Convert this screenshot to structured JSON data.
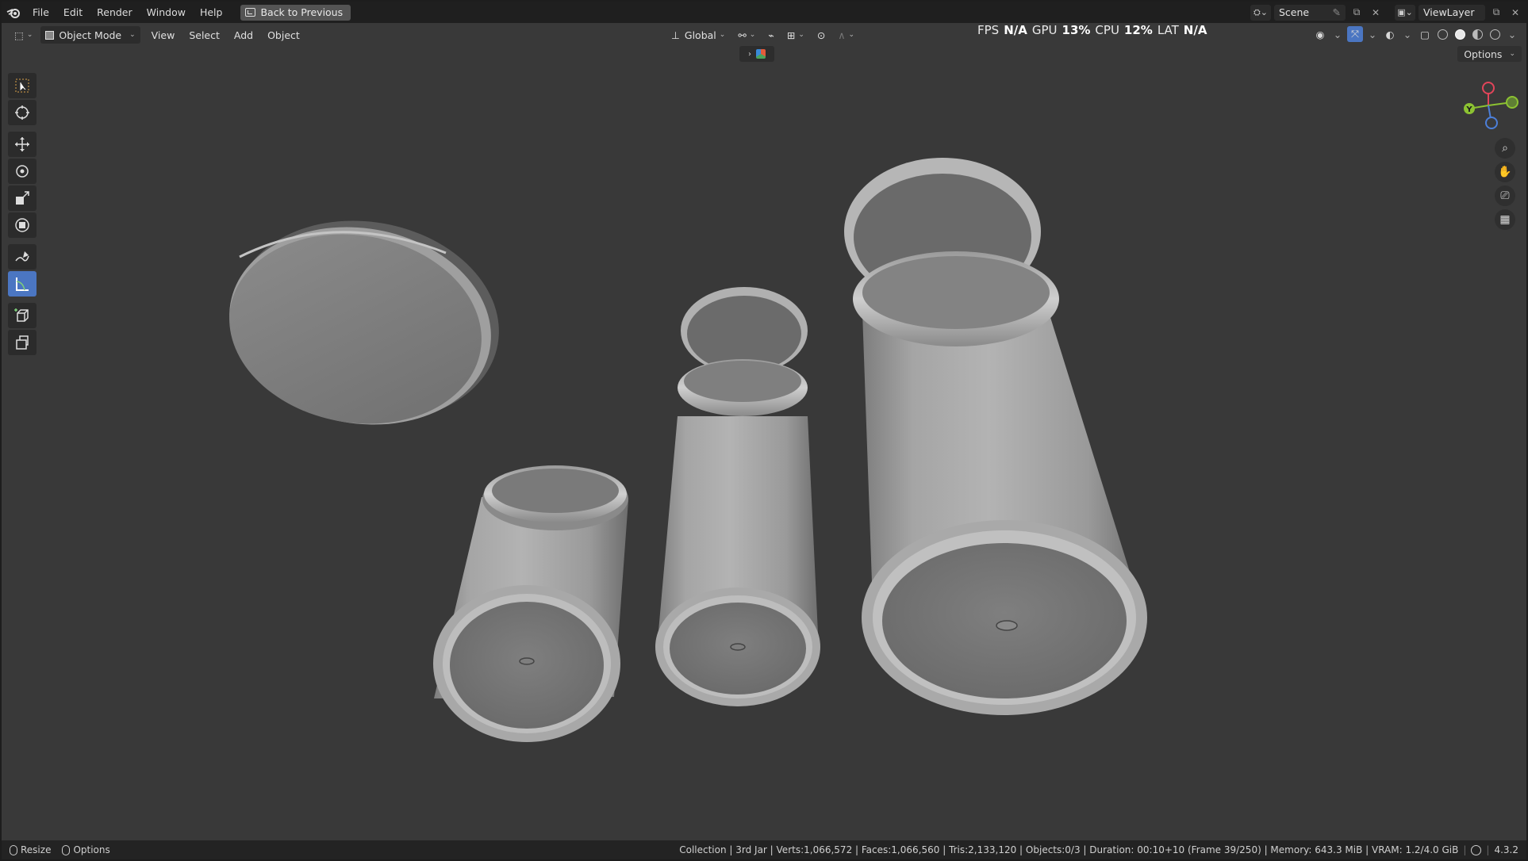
{
  "menubar": {
    "items": [
      "File",
      "Edit",
      "Render",
      "Window",
      "Help"
    ],
    "back_button": "Back to Previous"
  },
  "topright": {
    "scene": "Scene",
    "view_layer": "ViewLayer"
  },
  "header": {
    "mode": "Object Mode",
    "menus": [
      "View",
      "Select",
      "Add",
      "Object"
    ],
    "transform_orientation": "Global",
    "options": "Options"
  },
  "stats": {
    "fps_label": "FPS",
    "fps_value": "N/A",
    "gpu_label": "GPU",
    "gpu_value": "13%",
    "cpu_label": "CPU",
    "cpu_value": "12%",
    "lat_label": "LAT",
    "lat_value": "N/A"
  },
  "toolbar": {
    "tools": [
      "select-box",
      "cursor",
      "move",
      "rotate",
      "scale",
      "transform",
      "annotate",
      "measure",
      "add-cube",
      "extrude"
    ],
    "active": "measure"
  },
  "gizmo": {
    "y_label": "Y"
  },
  "statusbar": {
    "resize": "Resize",
    "options": "Options",
    "info": "Collection | 3rd Jar | Verts:1,066,572 | Faces:1,066,560 | Tris:2,133,120 | Objects:0/3 | Duration: 00:10+10 (Frame 39/250) | Memory: 643.3 MiB | VRAM: 1.2/4.0 GiB",
    "version": "4.3.2"
  },
  "colors": {
    "accent": "#4b76c2",
    "axis_x": "#e2455a",
    "axis_y": "#8cc232",
    "axis_z": "#4c7fd9",
    "viewport_bg": "#393939"
  }
}
